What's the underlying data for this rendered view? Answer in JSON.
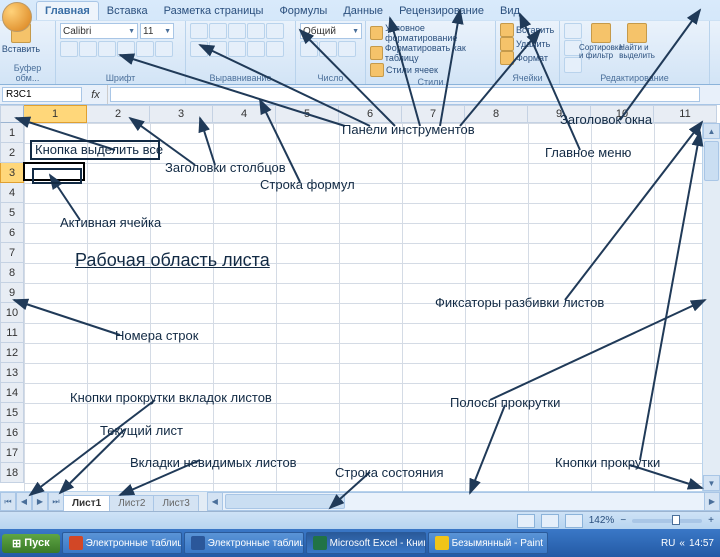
{
  "ribbon": {
    "tabs": [
      "Главная",
      "Вставка",
      "Разметка страницы",
      "Формулы",
      "Данные",
      "Рецензирование",
      "Вид"
    ],
    "active_tab": 0,
    "groups": {
      "clipboard": {
        "paste": "Вставить",
        "label": "Буфер обм..."
      },
      "font": {
        "name": "Calibri",
        "size": "11",
        "label": "Шрифт"
      },
      "alignment": {
        "label": "Выравнивание"
      },
      "number": {
        "format": "Общий",
        "label": "Число"
      },
      "styles": {
        "cond": "Условное форматирование",
        "fmttbl": "Форматировать как таблицу",
        "cellst": "Стили ячеек",
        "label": "Стили"
      },
      "cells": {
        "insert": "Вставить",
        "delete": "Удалить",
        "format": "Формат",
        "label": "Ячейки"
      },
      "editing": {
        "sort": "Сортировка и фильтр",
        "find": "Найти и выделить",
        "label": "Редактирование"
      }
    }
  },
  "formula_bar": {
    "name_box": "R3C1",
    "fx": "fx"
  },
  "columns": [
    "1",
    "2",
    "3",
    "4",
    "5",
    "6",
    "7",
    "8",
    "9",
    "10",
    "11"
  ],
  "rows": [
    "1",
    "2",
    "3",
    "4",
    "5",
    "6",
    "7",
    "8",
    "9",
    "10",
    "11",
    "12",
    "13",
    "14",
    "15",
    "16",
    "17",
    "18"
  ],
  "active_cell": {
    "row": 3,
    "col": 1
  },
  "sheet_tabs": {
    "items": [
      "Лист1",
      "Лист2",
      "Лист3"
    ],
    "active": 0
  },
  "status": {
    "zoom": "142%",
    "time": "14:57"
  },
  "taskbar": {
    "start": "Пуск",
    "items": [
      {
        "label": "Электронные таблицы...",
        "type": "ppt"
      },
      {
        "label": "Электронные таблицы...",
        "type": "word"
      },
      {
        "label": "Microsoft Excel - Книга...",
        "type": "excel",
        "active": true
      },
      {
        "label": "Безымянный - Paint",
        "type": "paint"
      }
    ],
    "lang": "RU"
  },
  "annotations": {
    "select_all": "Кнопка выделить все",
    "col_headers": "Заголовки столбцов",
    "toolbars": "Панели инструментов",
    "title": "Заголовок окна",
    "main_menu": "Главное меню",
    "formula_row": "Строка формул",
    "active_cell": "Активная ячейка",
    "work_area": "Рабочая область листа",
    "split": "Фиксаторы разбивки листов",
    "row_nums": "Номера строк",
    "scroll_btns": "Кнопки прокрутки вкладок листов",
    "scrollbars": "Полосы прокрутки",
    "cur_sheet": "Текущий лист",
    "hidden_tabs": "Вкладки невидимых листов",
    "status_row": "Строка состояния",
    "scroll_btns2": "Кнопки прокрутки"
  }
}
